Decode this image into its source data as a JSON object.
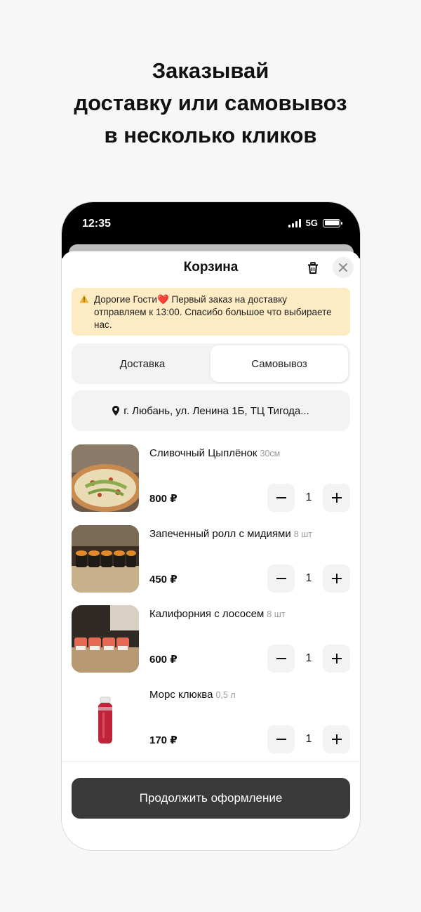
{
  "headline": {
    "line1": "Заказывай",
    "line2": "доставку или самовывоз",
    "line3": "в несколько кликов"
  },
  "status_bar": {
    "time": "12:35",
    "network": "5G"
  },
  "cart": {
    "title": "Корзина",
    "trash_icon": "trash-icon",
    "close_icon": "close-icon",
    "notice": {
      "text_before_heart": "Дорогие Гости",
      "heart": "❤️",
      "text_after_heart": " Первый заказ на доставку отправляем к 13:00. Спасибо большое что выбираете нас.",
      "icon": "warning-icon"
    },
    "modes": {
      "delivery": "Доставка",
      "pickup": "Самовывоз",
      "selected": "pickup"
    },
    "address": "г. Любань, ул. Ленина 1Б, ТЦ Тигода...",
    "items": [
      {
        "name": "Сливочный Цыплёнок",
        "size": "30см",
        "price": "800 ₽",
        "qty": "1"
      },
      {
        "name": "Запеченный ролл с мидиями",
        "size": "8 шт",
        "price": "450 ₽",
        "qty": "1"
      },
      {
        "name": "Калифорния с лососем",
        "size": "8 шт",
        "price": "600 ₽",
        "qty": "1"
      },
      {
        "name": "Морс клюква",
        "size": "0,5 л",
        "price": "170 ₽",
        "qty": "1"
      }
    ],
    "continue_label": "Продолжить оформление"
  },
  "colors": {
    "notice_bg": "#fdebc4",
    "button_dark": "#3a3a3a",
    "chip_bg": "#f3f3f3"
  }
}
